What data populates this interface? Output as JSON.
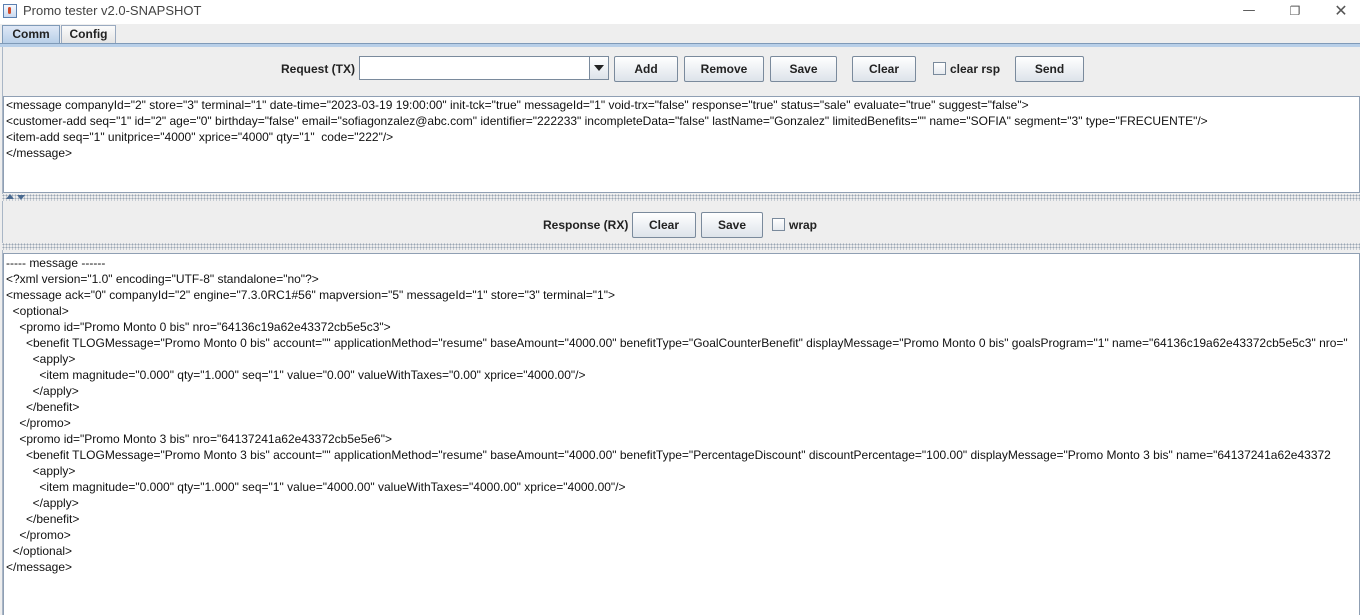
{
  "window": {
    "title": "Promo tester v2.0-SNAPSHOT",
    "controls": {
      "minimize": "—",
      "maximize": "❐",
      "close": "✕"
    }
  },
  "tabs": [
    {
      "label": "Comm",
      "active": true
    },
    {
      "label": "Config",
      "active": false
    }
  ],
  "request": {
    "label": "Request (TX)",
    "combo_value": "",
    "add_label": "Add",
    "remove_label": "Remove",
    "save_label": "Save",
    "clear_label": "Clear",
    "clear_rsp_label": "clear rsp",
    "clear_rsp_checked": false,
    "send_label": "Send",
    "lines": [
      "<message companyId=\"2\" store=\"3\" terminal=\"1\" date-time=\"2023-03-19 19:00:00\" init-tck=\"true\" messageId=\"1\" void-trx=\"false\" response=\"true\" status=\"sale\" evaluate=\"true\" suggest=\"false\">",
      "<customer-add seq=\"1\" id=\"2\" age=\"0\" birthday=\"false\" email=\"sofiagonzalez@abc.com\" identifier=\"222233\" incompleteData=\"false\" lastName=\"Gonzalez\" limitedBenefits=\"\" name=\"SOFIA\" segment=\"3\" type=\"FRECUENTE\"/>",
      "<item-add seq=\"1\" unitprice=\"4000\" xprice=\"4000\" qty=\"1\"  code=\"222\"/>",
      "</message>"
    ]
  },
  "response": {
    "label": "Response (RX)",
    "clear_label": "Clear",
    "save_label": "Save",
    "wrap_label": "wrap",
    "wrap_checked": false,
    "lines": [
      "----- message ------",
      "<?xml version=\"1.0\" encoding=\"UTF-8\" standalone=\"no\"?>",
      "<message ack=\"0\" companyId=\"2\" engine=\"7.3.0RC1#56\" mapversion=\"5\" messageId=\"1\" store=\"3\" terminal=\"1\">",
      "  <optional>",
      "    <promo id=\"Promo Monto 0 bis\" nro=\"64136c19a62e43372cb5e5c3\">",
      "      <benefit TLOGMessage=\"Promo Monto 0 bis\" account=\"\" applicationMethod=\"resume\" baseAmount=\"4000.00\" benefitType=\"GoalCounterBenefit\" displayMessage=\"Promo Monto 0 bis\" goalsProgram=\"1\" name=\"64136c19a62e43372cb5e5c3\" nro=\"",
      "        <apply>",
      "          <item magnitude=\"0.000\" qty=\"1.000\" seq=\"1\" value=\"0.00\" valueWithTaxes=\"0.00\" xprice=\"4000.00\"/>",
      "        </apply>",
      "      </benefit>",
      "    </promo>",
      "    <promo id=\"Promo Monto 3 bis\" nro=\"64137241a62e43372cb5e5e6\">",
      "      <benefit TLOGMessage=\"Promo Monto 3 bis\" account=\"\" applicationMethod=\"resume\" baseAmount=\"4000.00\" benefitType=\"PercentageDiscount\" discountPercentage=\"100.00\" displayMessage=\"Promo Monto 3 bis\" name=\"64137241a62e43372",
      "        <apply>",
      "          <item magnitude=\"0.000\" qty=\"1.000\" seq=\"1\" value=\"4000.00\" valueWithTaxes=\"4000.00\" xprice=\"4000.00\"/>",
      "        </apply>",
      "      </benefit>",
      "    </promo>",
      "  </optional>",
      "</message>"
    ]
  }
}
